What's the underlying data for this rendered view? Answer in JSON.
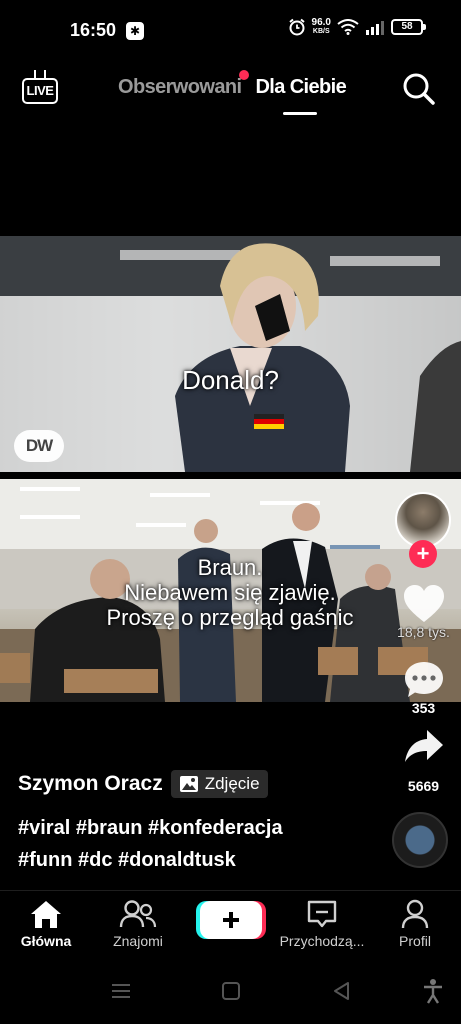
{
  "status_bar": {
    "time": "16:50",
    "network_speed": "96.0",
    "network_unit": "KB/S",
    "battery": "58"
  },
  "top_nav": {
    "live_label": "LIVE",
    "tab_following": "Obserwowani",
    "tab_for_you": "Dla Ciebie",
    "notification_dot_color": "#fe2c55"
  },
  "post": {
    "photo1_caption": "Donald?",
    "photo1_watermark": "DW",
    "photo2_caption_lines": [
      "Braun.",
      "Niebawem się zjawię.",
      "Proszę o przegląd gaśnic"
    ],
    "like_count": "18,8 tys.",
    "comment_count": "353",
    "share_count": "5669",
    "author": "Szymon Oracz",
    "type_badge": "Zdjęcie",
    "description_lines": [
      "#viral #braun #konfederacja",
      "#funn #dc #donaldtusk"
    ]
  },
  "bottom_nav": {
    "home": "Główna",
    "friends": "Znajomi",
    "inbox": "Przychodzą...",
    "profile": "Profil"
  },
  "colors": {
    "accent_red": "#fe2c55",
    "accent_cyan": "#25f4ee",
    "background": "#000000"
  }
}
